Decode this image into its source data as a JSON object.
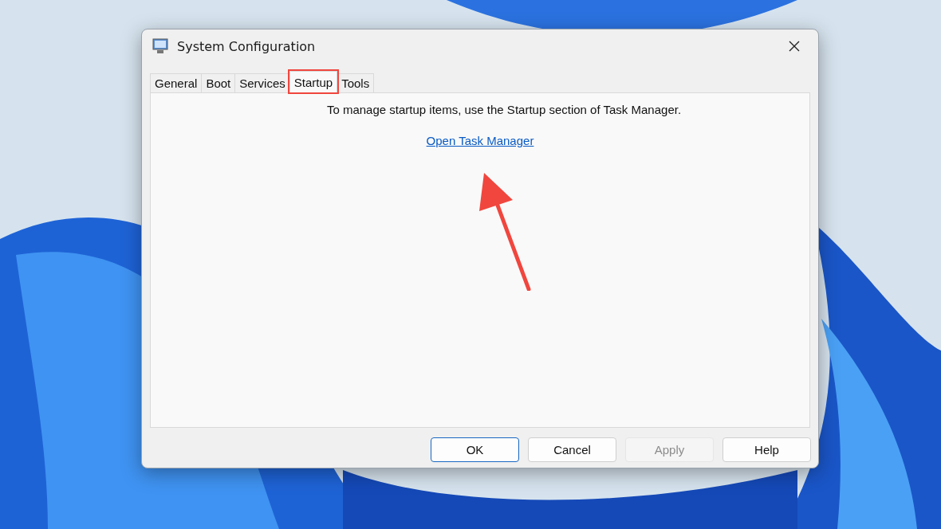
{
  "window": {
    "title": "System Configuration"
  },
  "tabs": [
    {
      "label": "General",
      "selected": false,
      "highlighted": false
    },
    {
      "label": "Boot",
      "selected": false,
      "highlighted": false
    },
    {
      "label": "Services",
      "selected": false,
      "highlighted": false
    },
    {
      "label": "Startup",
      "selected": true,
      "highlighted": true
    },
    {
      "label": "Tools",
      "selected": false,
      "highlighted": false
    }
  ],
  "panel": {
    "message": "To manage startup items, use the Startup section of Task Manager.",
    "link": "Open Task Manager",
    "annotation_arrow": true
  },
  "buttons": [
    {
      "label": "OK",
      "default": true,
      "disabled": false
    },
    {
      "label": "Cancel",
      "default": false,
      "disabled": false
    },
    {
      "label": "Apply",
      "default": false,
      "disabled": true
    },
    {
      "label": "Help",
      "default": false,
      "disabled": false
    }
  ]
}
